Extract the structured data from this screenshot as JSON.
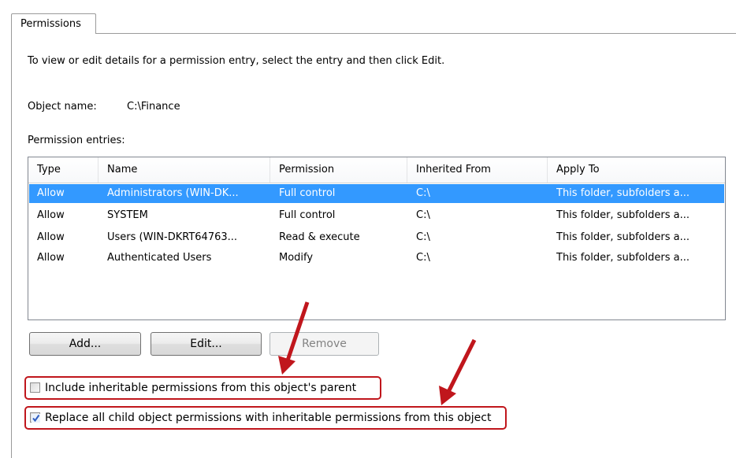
{
  "tab": {
    "label": "Permissions"
  },
  "instructions": "To view or edit details for a permission entry, select the entry and then click Edit.",
  "object_name": {
    "label": "Object name:",
    "value": "C:\\Finance"
  },
  "entries_label": "Permission entries:",
  "table": {
    "columns": [
      "Type",
      "Name",
      "Permission",
      "Inherited From",
      "Apply To"
    ],
    "rows": [
      [
        "Allow",
        "Administrators (WIN-DK...",
        "Full control",
        "C:\\",
        "This folder, subfolders a..."
      ],
      [
        "Allow",
        "SYSTEM",
        "Full control",
        "C:\\",
        "This folder, subfolders a..."
      ],
      [
        "Allow",
        "Users (WIN-DKRT64763...",
        "Read & execute",
        "C:\\",
        "This folder, subfolders a..."
      ],
      [
        "Allow",
        "Authenticated Users",
        "Modify",
        "C:\\",
        "This folder, subfolders a..."
      ]
    ],
    "selected_row": 0
  },
  "buttons": {
    "add": "Add...",
    "edit": "Edit...",
    "remove": "Remove"
  },
  "checkboxes": {
    "include_inheritable": {
      "label": "Include inheritable permissions from this object's parent",
      "checked": false
    },
    "replace_child": {
      "label": "Replace all child object permissions with inheritable permissions from this object",
      "checked": true
    }
  },
  "colors": {
    "selection": "#3399ff",
    "annotation": "#c0161c"
  }
}
